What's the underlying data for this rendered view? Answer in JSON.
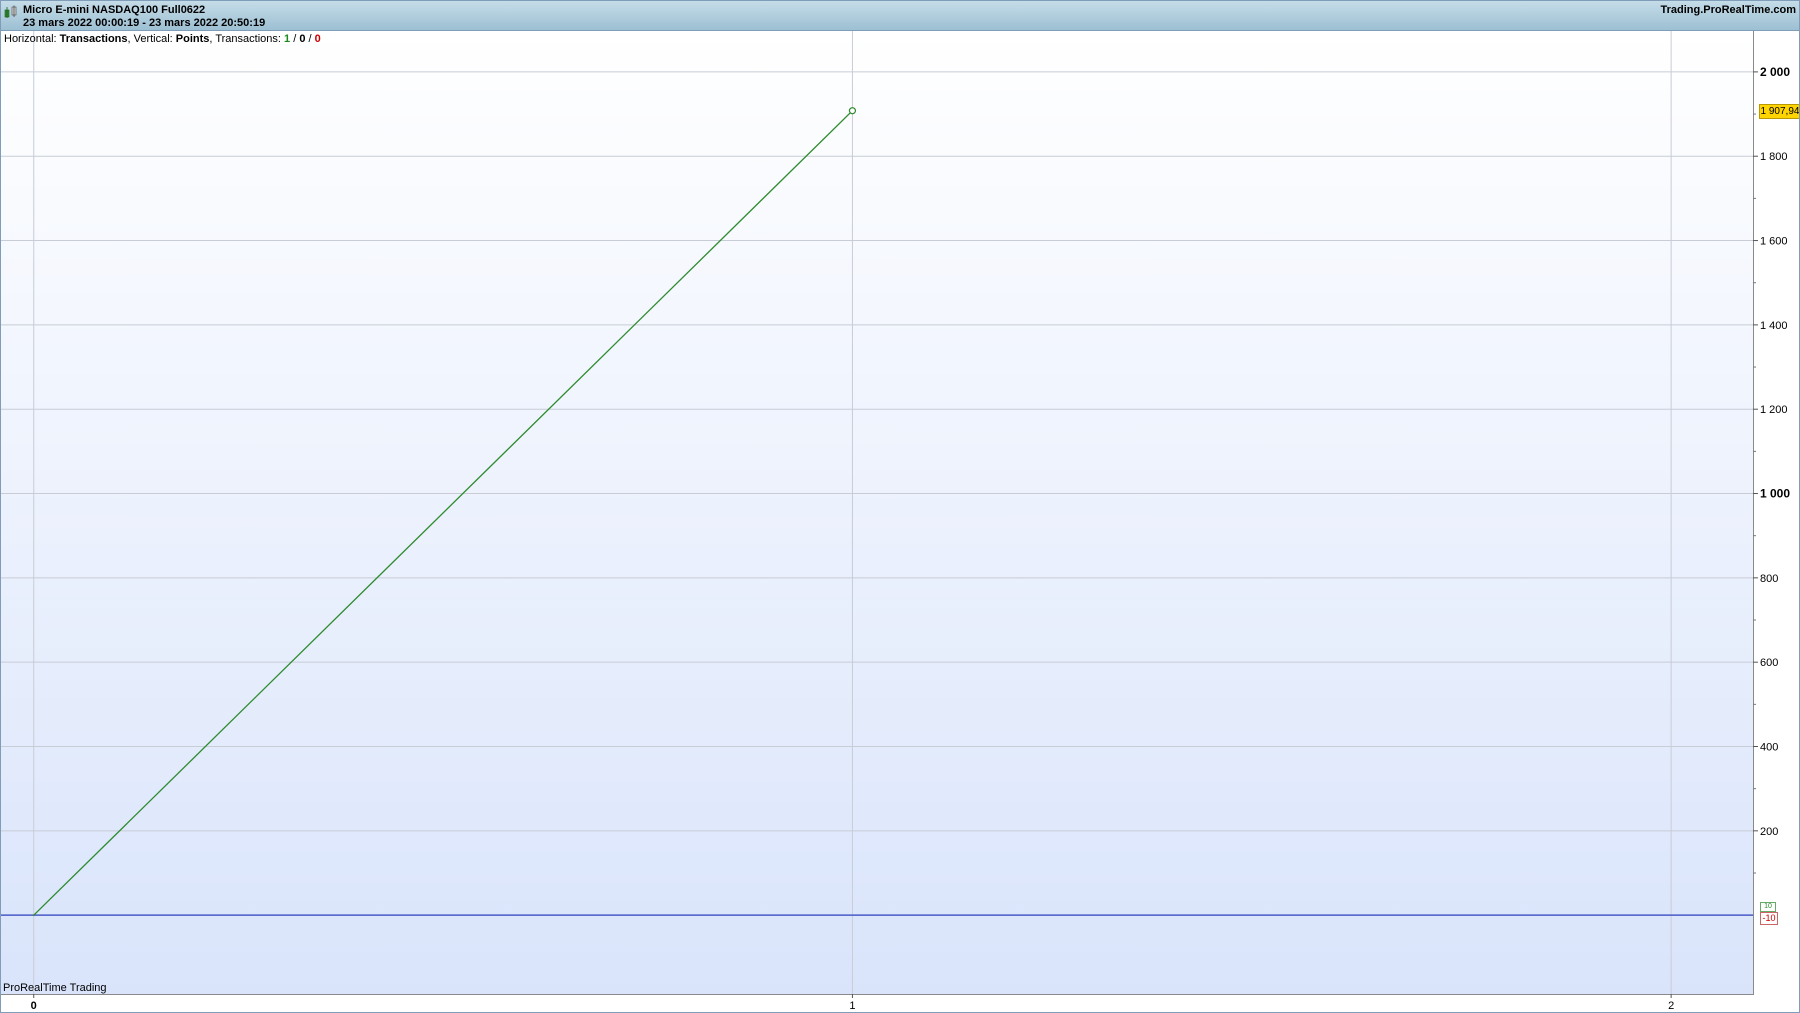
{
  "window": {
    "instrument": "Micro E-mini NASDAQ100 Full0622",
    "date_range": "23 mars 2022 00:00:19 - 23 mars 2022 20:50:19",
    "brand": "Trading.ProRealTime.com",
    "icon": "candlestick-chart-icon"
  },
  "info": {
    "horizontal_label": "Horizontal: ",
    "horizontal_value": "Transactions",
    "vertical_label": ", Vertical: ",
    "vertical_value": "Points",
    "transactions_label": ", Transactions: ",
    "count_winning": "1",
    "sep1": " / ",
    "count_neutral": "0",
    "sep2": " / ",
    "count_losing": "0"
  },
  "footer": "ProRealTime Trading",
  "badges": {
    "last_value": "1 907,94",
    "negative_marker": "-10",
    "positive_marker": "10"
  },
  "colors": {
    "equity_line": "#2e8b2e",
    "zero_line": "#4a5bc8",
    "badge_bg": "#ffd400",
    "grid": "#c8ccd6"
  },
  "chart_data": {
    "type": "line",
    "title": "",
    "xlabel": "Transactions",
    "ylabel": "Points",
    "xlim": [
      -0.04,
      2.1
    ],
    "ylim": [
      -187,
      2097
    ],
    "grid": true,
    "x_ticks": [
      {
        "value": 0,
        "label": "0",
        "major": true
      },
      {
        "value": 1,
        "label": "1",
        "major": false
      },
      {
        "value": 2,
        "label": "2",
        "major": false
      }
    ],
    "y_ticks": [
      {
        "value": 200,
        "label": "200",
        "major": false
      },
      {
        "value": 400,
        "label": "400",
        "major": false
      },
      {
        "value": 600,
        "label": "600",
        "major": false
      },
      {
        "value": 800,
        "label": "800",
        "major": false
      },
      {
        "value": 1000,
        "label": "1 000",
        "major": true
      },
      {
        "value": 1200,
        "label": "1 200",
        "major": false
      },
      {
        "value": 1400,
        "label": "1 400",
        "major": false
      },
      {
        "value": 1600,
        "label": "1 600",
        "major": false
      },
      {
        "value": 1800,
        "label": "1 800",
        "major": false
      },
      {
        "value": 2000,
        "label": "2 000",
        "major": true
      }
    ],
    "zero_line": 0,
    "series": [
      {
        "x": [
          0,
          1
        ],
        "y": [
          0,
          1907.94
        ]
      }
    ]
  }
}
